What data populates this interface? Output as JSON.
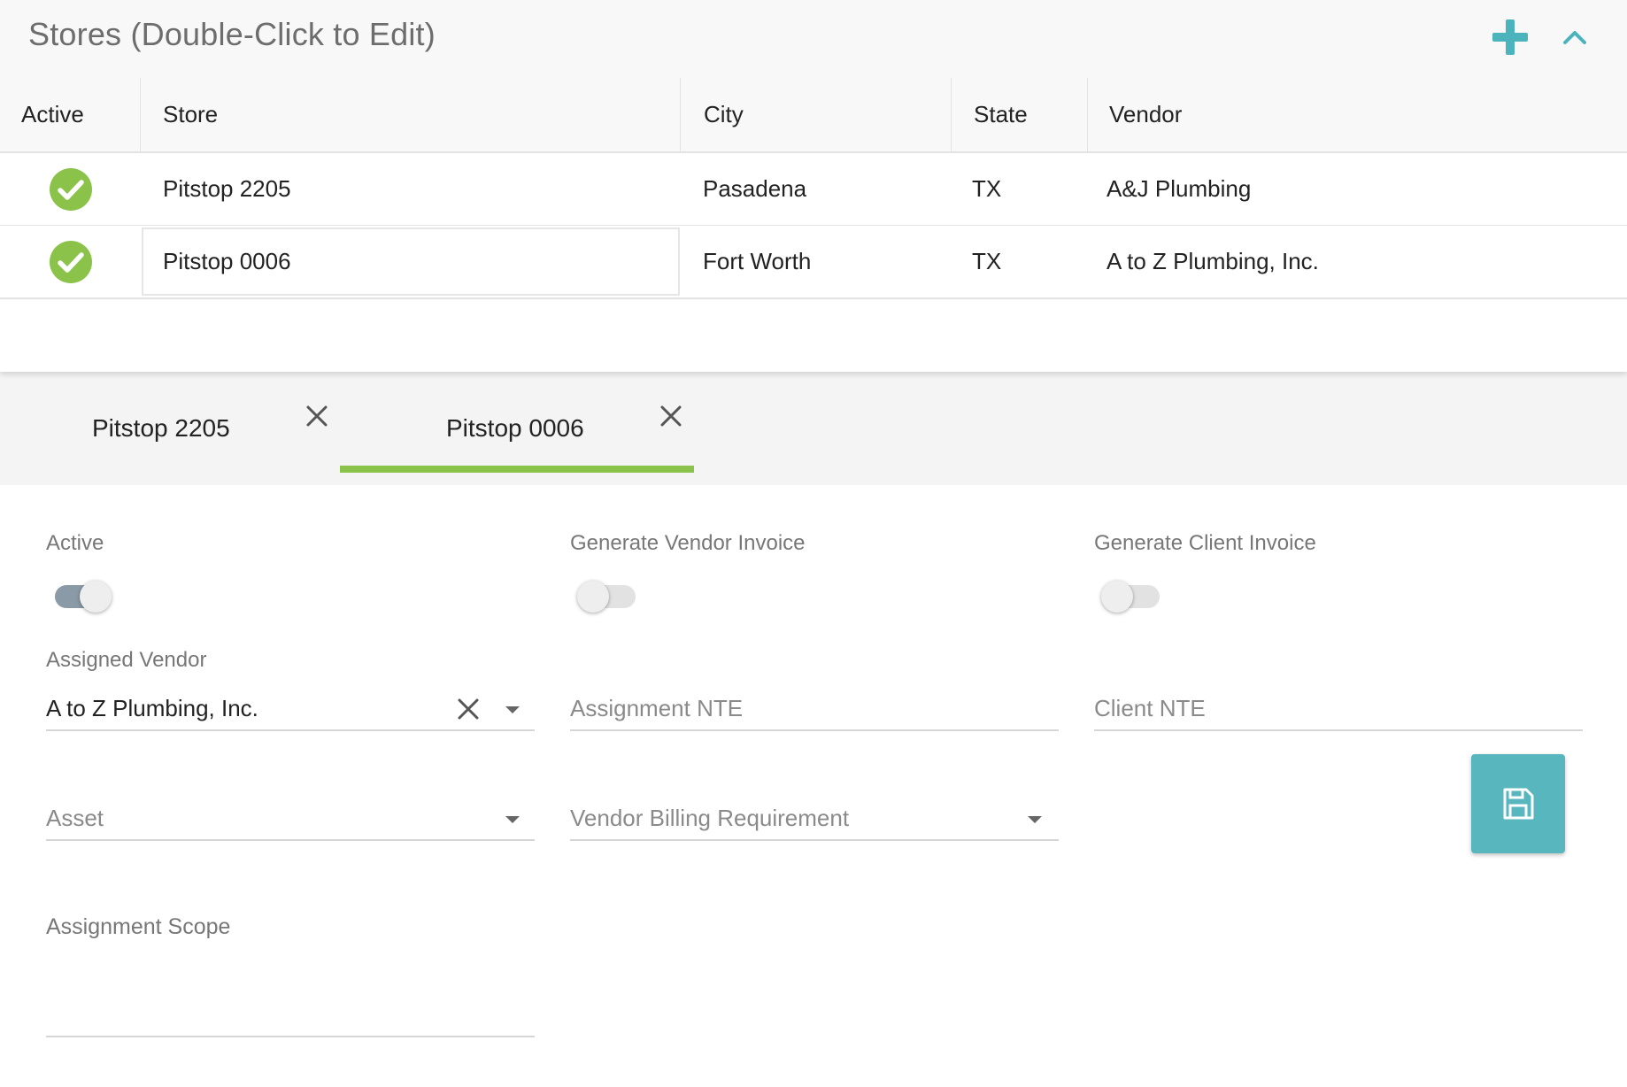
{
  "stores_panel": {
    "title": "Stores (Double-Click to Edit)",
    "add_icon": "plus-icon",
    "collapse_icon": "chevron-up-icon",
    "accent_color": "#4ab3bc",
    "columns": [
      "Active",
      "Store",
      "City",
      "State",
      "Vendor"
    ],
    "rows": [
      {
        "active": true,
        "store": "Pitstop 2205",
        "city": "Pasadena",
        "state": "TX",
        "vendor": "A&J Plumbing"
      },
      {
        "active": true,
        "store": "Pitstop 0006",
        "city": "Fort Worth",
        "state": "TX",
        "vendor": "A to Z Plumbing, Inc."
      }
    ],
    "active_icon": "check-circle-icon",
    "active_color": "#8bc34a"
  },
  "tabs": [
    {
      "label": "Pitstop 2205",
      "selected": false,
      "close_icon": "close-icon"
    },
    {
      "label": "Pitstop 0006",
      "selected": true,
      "close_icon": "close-icon"
    }
  ],
  "tab_underline_color": "#8bc34a",
  "form": {
    "active": {
      "label": "Active",
      "on": true
    },
    "generate_vendor_invoice": {
      "label": "Generate Vendor Invoice",
      "on": false
    },
    "generate_client_invoice": {
      "label": "Generate Client Invoice",
      "on": false
    },
    "assigned_vendor": {
      "label": "Assigned Vendor",
      "value": "A to Z Plumbing, Inc."
    },
    "assignment_nte": {
      "placeholder": "Assignment NTE",
      "value": ""
    },
    "client_nte": {
      "placeholder": "Client NTE",
      "value": ""
    },
    "asset": {
      "placeholder": "Asset",
      "value": ""
    },
    "vendor_billing_requirement": {
      "placeholder": "Vendor Billing Requirement",
      "value": ""
    },
    "assignment_scope": {
      "label": "Assignment Scope",
      "value": ""
    },
    "save_icon": "save-icon",
    "save_color": "#58b6be"
  }
}
